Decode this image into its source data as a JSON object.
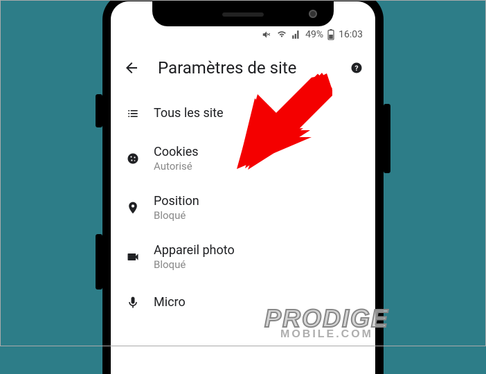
{
  "status": {
    "battery": "49%",
    "time": "16:03"
  },
  "header": {
    "title": "Paramètres de site"
  },
  "rows": {
    "all_sites": {
      "label": "Tous les site"
    },
    "cookies": {
      "label": "Cookies",
      "sub": "Autorisé"
    },
    "position": {
      "label": "Position",
      "sub": "Bloqué"
    },
    "camera": {
      "label": "Appareil photo",
      "sub": "Bloqué"
    },
    "micro": {
      "label": "Micro"
    }
  },
  "watermark": {
    "line1": "PRODIGE",
    "line2": "MOBILE.COM"
  }
}
